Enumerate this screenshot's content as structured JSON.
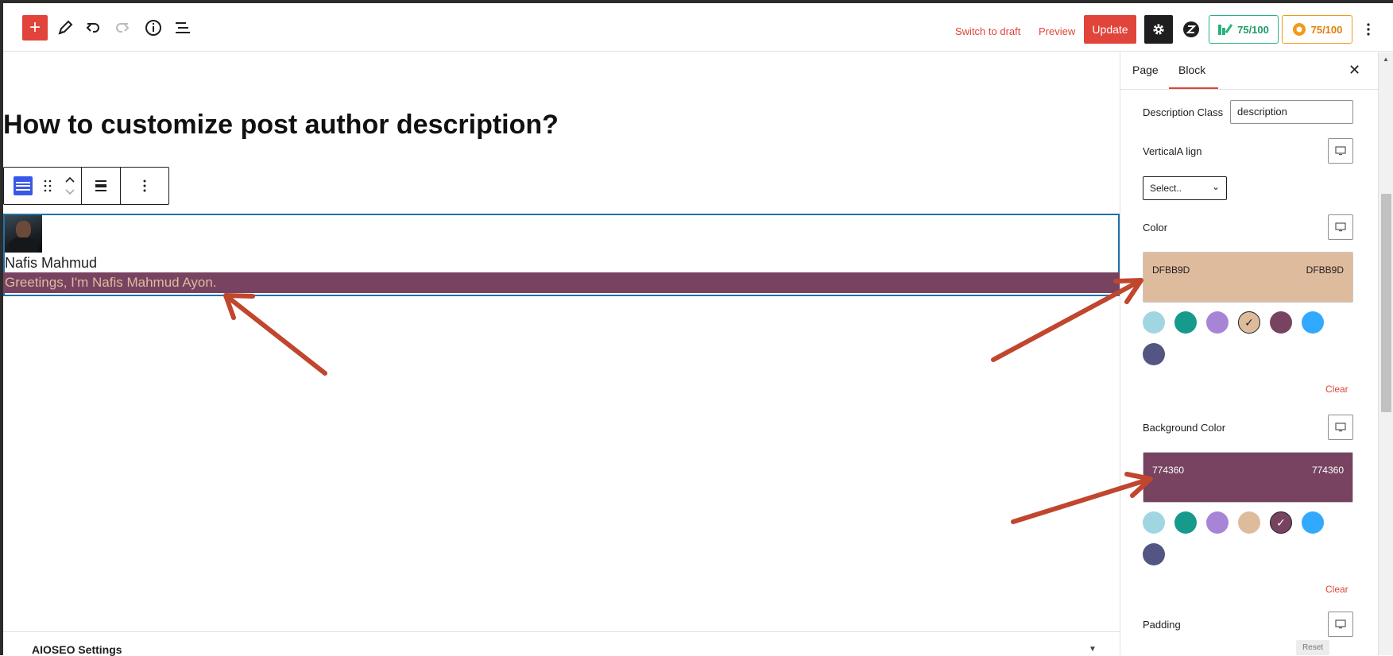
{
  "header": {
    "add_block_symbol": "+",
    "switch_to_draft_label": "Switch to draft",
    "preview_label": "Preview",
    "update_label": "Update",
    "score_green": "75/100",
    "score_orange": "75/100",
    "icons": [
      "edit-pencil-icon",
      "undo-icon",
      "redo-icon",
      "info-icon",
      "list-view-icon",
      "gear-icon",
      "seo-icon",
      "more-vertical-icon"
    ]
  },
  "editor": {
    "post_title": "How to customize post author description?",
    "author_name": "Nafis Mahmud",
    "author_description": "Greetings, I'm Nafis Mahmud Ayon."
  },
  "footer_panel": {
    "label": "AIOSEO Settings"
  },
  "sidebar": {
    "tabs": [
      {
        "label": "Page"
      },
      {
        "label": "Block"
      }
    ],
    "active_tab": "Block",
    "close_symbol": "✕",
    "description_class_label": "Description Class",
    "description_class_value": "description",
    "vertical_align_label": "VerticalA lign",
    "vertical_align_select": "Select..",
    "color": {
      "label": "Color",
      "value": "DFBB9D",
      "clear_label": "Clear"
    },
    "background_color": {
      "label": "Background Color",
      "value": "774360",
      "clear_label": "Clear"
    },
    "padding_label": "Padding",
    "reset_label": "Reset",
    "palette": [
      "#9fd6e1",
      "#159a8c",
      "#a884d6",
      "#dfbb9d",
      "#774360",
      "#31a9ff",
      "#535682"
    ],
    "selected_check": "✓"
  },
  "colors": {
    "accent": "#e0443a",
    "description_text": "#dfbb9d",
    "description_background": "#774360",
    "block_border": "#1d72aa",
    "annotation_arrow": "#c0462e"
  }
}
